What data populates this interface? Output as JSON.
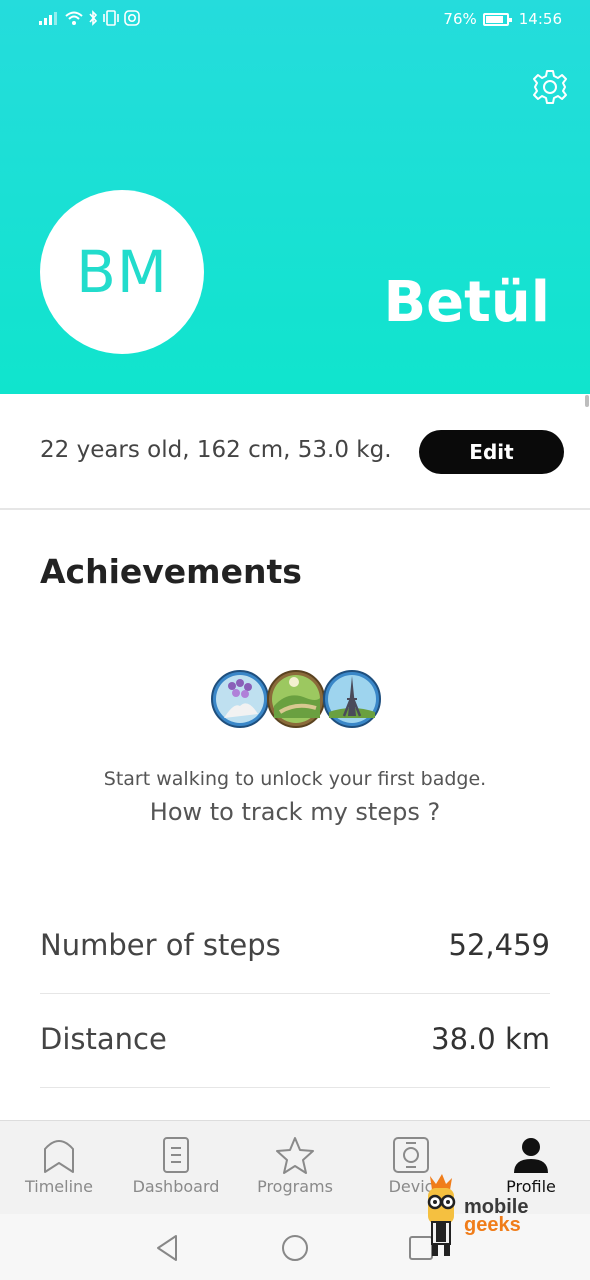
{
  "status_bar": {
    "battery": "76%",
    "time": "14:56"
  },
  "profile": {
    "initials": "BM",
    "name": "Betül",
    "details": "22 years old, 162 cm, 53.0 kg.",
    "edit_label": "Edit"
  },
  "achievements": {
    "title": "Achievements",
    "message": "Start walking to unlock your first badge.",
    "link": "How to track my steps ?"
  },
  "stats": [
    {
      "label": "Number of steps",
      "value": "52,459"
    },
    {
      "label": "Distance",
      "value": "38.0 km"
    }
  ],
  "nav": [
    {
      "label": "Timeline",
      "icon": "timeline-icon"
    },
    {
      "label": "Dashboard",
      "icon": "dashboard-icon"
    },
    {
      "label": "Programs",
      "icon": "star-icon"
    },
    {
      "label": "Devic",
      "icon": "watch-icon"
    },
    {
      "label": "Profile",
      "icon": "person-icon",
      "active": true
    }
  ],
  "watermark": {
    "line1": "mobile",
    "line2": "geeks"
  },
  "colors": {
    "header_gradient_top": "#25dcdc",
    "header_gradient_bottom": "#10e4cd",
    "edit_button": "#0a0a0a",
    "watermark_orange": "#f07d1a"
  }
}
